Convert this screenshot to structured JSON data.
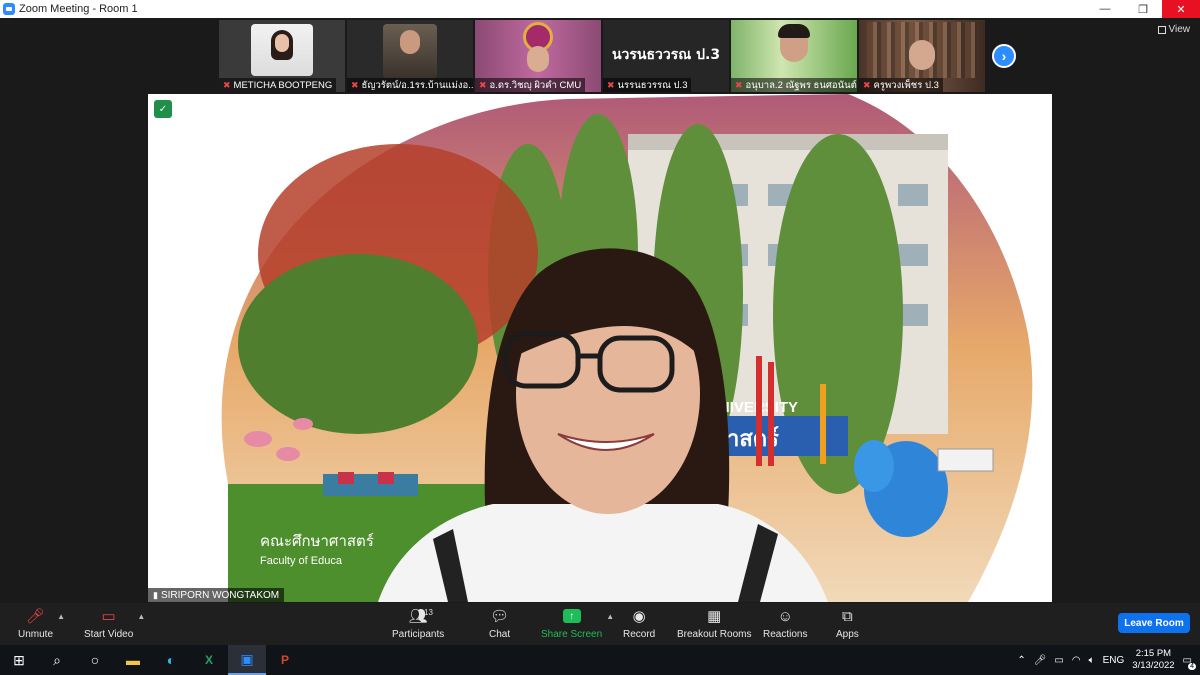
{
  "window": {
    "title": "Zoom Meeting - Room 1",
    "controls": {
      "minimize": "—",
      "restore": "❐",
      "close": "✕"
    }
  },
  "view": {
    "label": "View"
  },
  "participants_strip": [
    {
      "name": "METICHA BOOTPENG",
      "muted": true
    },
    {
      "name": "ธัญวรัตน์/อ.1รร.บ้านแม่งอ...",
      "muted": true
    },
    {
      "name": "อ.ดร.วิชญุ ผิวคำ CMU",
      "muted": true
    },
    {
      "name": "นรรนธวรรณ ป.3",
      "muted": true,
      "display_text": "นวรนธววรณ ป.3"
    },
    {
      "name": "อนุบาล.2 ณัฐพร ธนศอนันต์สั...",
      "muted": true
    },
    {
      "name": "ครูพวงเพ็ชร ป.3",
      "muted": true
    }
  ],
  "active_speaker": {
    "name": "SIRIPORN WONGTAKOM",
    "background_text_1": "UNIVERSITY",
    "background_text_2": "คณะศึกษาศาสตร์",
    "background_text_3": "Faculty of Educa",
    "background_text_4": "ศาสตร์"
  },
  "toolbar": {
    "unmute": "Unmute",
    "start_video": "Start Video",
    "participants": "Participants",
    "participants_count": "13",
    "chat": "Chat",
    "share_screen": "Share Screen",
    "record": "Record",
    "breakout_rooms": "Breakout Rooms",
    "reactions": "Reactions",
    "apps": "Apps",
    "leave_room": "Leave Room"
  },
  "taskbar": {
    "language": "ENG",
    "time": "2:15 PM",
    "date": "3/13/2022",
    "notification_count": "4"
  },
  "colors": {
    "accent": "#2d8cff",
    "share_green": "#1fbd5a",
    "muted_red": "#e8474c",
    "leave_blue": "#0e72ed"
  }
}
